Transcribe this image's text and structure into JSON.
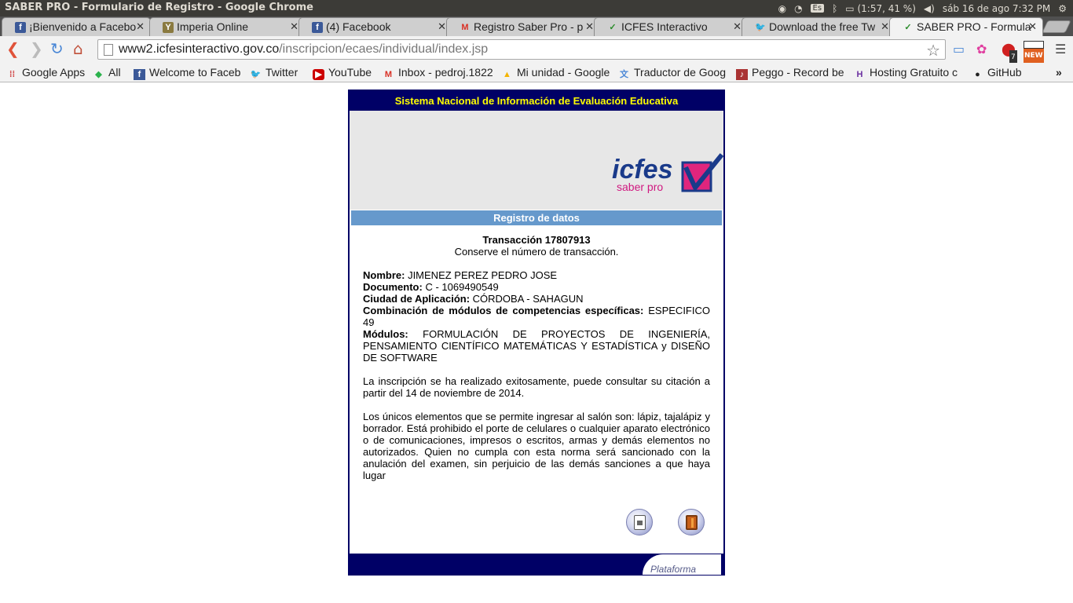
{
  "os": {
    "window_title": "SABER PRO - Formulario de Registro - Google Chrome",
    "keyboard": "Es",
    "battery": "(1:57, 41 %)",
    "datetime": "sáb 16 de ago  7:32 PM"
  },
  "tabs": [
    {
      "label": "¡Bienvenido a Facebo",
      "icon": "facebook-icon",
      "active": false
    },
    {
      "label": "Imperia Online",
      "icon": "imperia-icon",
      "active": false
    },
    {
      "label": "(4) Facebook",
      "icon": "facebook-icon",
      "active": false
    },
    {
      "label": "Registro Saber Pro - p",
      "icon": "gmail-icon",
      "active": false
    },
    {
      "label": "ICFES Interactivo",
      "icon": "icfes-icon",
      "active": false
    },
    {
      "label": "Download the free Tw",
      "icon": "twitter-icon",
      "active": false
    },
    {
      "label": "SABER PRO - Formula",
      "icon": "icfes-icon",
      "active": true
    }
  ],
  "omnibox": {
    "host": "www2.icfesinteractivo.gov.co",
    "path": "/inscripcion/ecaes/individual/index.jsp"
  },
  "extensions": {
    "badge_count": "7",
    "new_badge": "NEW"
  },
  "bookmarks": [
    {
      "label": "Google Apps",
      "icon": "apps-icon"
    },
    {
      "label": "All",
      "icon": "feedly-icon"
    },
    {
      "label": "Welcome to Faceb",
      "icon": "facebook-icon"
    },
    {
      "label": "Twitter",
      "icon": "twitter-icon"
    },
    {
      "label": "YouTube",
      "icon": "youtube-icon"
    },
    {
      "label": "Inbox - pedroj.1822",
      "icon": "gmail-icon"
    },
    {
      "label": "Mi unidad - Google",
      "icon": "drive-icon"
    },
    {
      "label": "Traductor de Goog",
      "icon": "translate-icon"
    },
    {
      "label": "Peggo - Record be",
      "icon": "peggo-icon"
    },
    {
      "label": "Hosting Gratuito c",
      "icon": "hosting-icon"
    },
    {
      "label": "GitHub",
      "icon": "github-icon"
    }
  ],
  "page": {
    "header": "Sistema Nacional de Información de Evaluación Educativa",
    "logo_text": "icfes",
    "logo_subtext": "saber pro",
    "section_title": "Registro de datos",
    "transaction_title": "Transacción 17807913",
    "transaction_note": "Conserve el número de transacción.",
    "fields": {
      "nombre_label": "Nombre:",
      "nombre_value": " JIMENEZ PEREZ PEDRO JOSE",
      "documento_label": "Documento:",
      "documento_value": " C - 1069490549",
      "ciudad_label": "Ciudad de Aplicación:",
      "ciudad_value": " CÓRDOBA - SAHAGUN",
      "combinacion_label": "Combinación de módulos de competencias específicas:",
      "combinacion_value": " ESPECIFICO 49",
      "modulos_label": "Módulos:",
      "modulos_value": " FORMULACIÓN DE PROYECTOS DE INGENIERÍA, PENSAMIENTO CIENTÍFICO MATEMÁTICAS Y ESTADÍSTICA y DISEÑO DE SOFTWARE"
    },
    "success_message": "La inscripción se ha realizado exitosamente, puede consultar su citación a partir del 14 de noviembre de 2014.",
    "rules_message": "Los únicos elementos que se permite ingresar al salón son: lápiz, tajalápiz y borrador. Está prohibido el porte de celulares o cualquier aparato electrónico o de comunicaciones, impresos o escritos, armas y demás elementos no autorizados. Quien no cumpla con esta norma será sancionado con la anulación del examen, sin perjuicio de las demás sanciones a que haya lugar",
    "footer_brand": "Plataforma"
  }
}
